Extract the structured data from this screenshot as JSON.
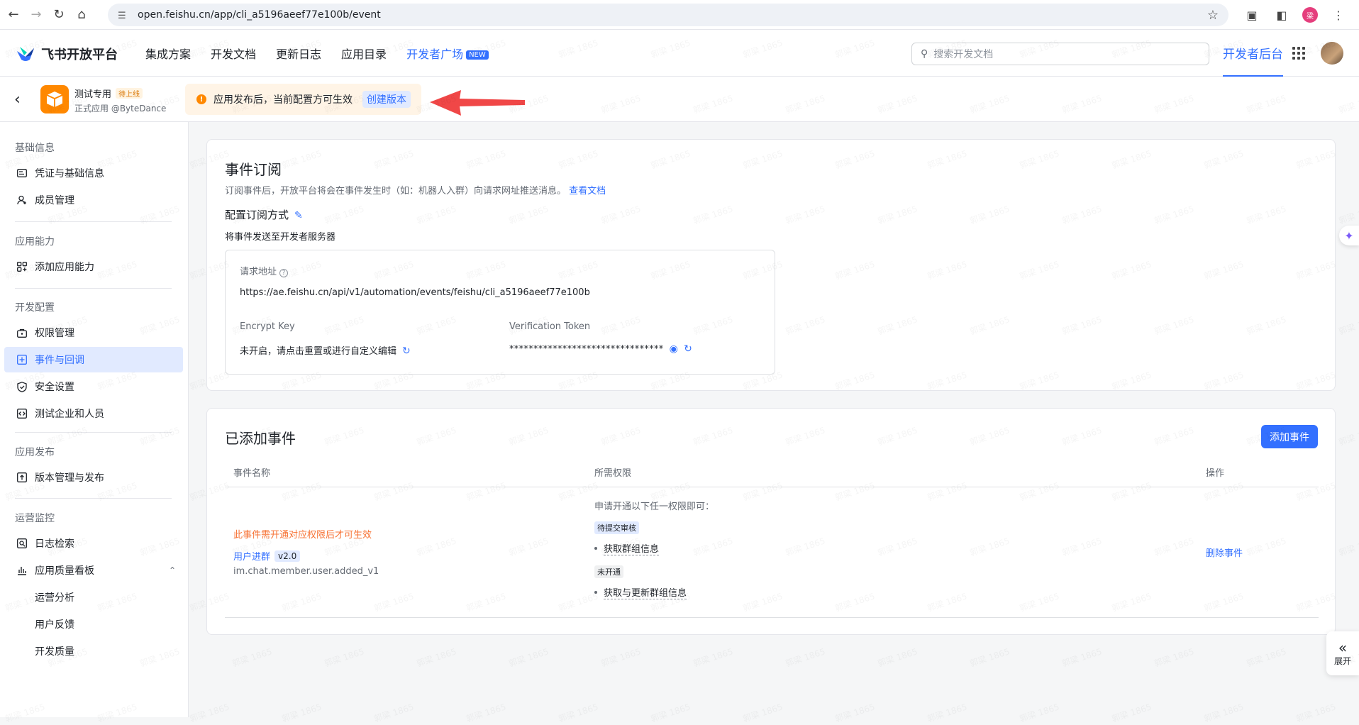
{
  "browser": {
    "url": "open.feishu.cn/app/cli_a5196aeef77e100b/event",
    "profile_initial": "梁",
    "icons": [
      "back-icon",
      "forward-icon",
      "reload-icon",
      "home-icon",
      "tune-icon",
      "star-icon",
      "extensions-icon",
      "sidepanel-icon",
      "menu-icon"
    ]
  },
  "header": {
    "logo_text": "飞书开放平台",
    "nav": [
      "集成方案",
      "开发文档",
      "更新日志",
      "应用目录"
    ],
    "nav_highlight": "开发者广场",
    "new_badge": "NEW",
    "search_placeholder": "搜索开发文档",
    "console": "开发者后台"
  },
  "app": {
    "name": "测试专用",
    "status": "待上线",
    "subtitle": "正式应用 @ByteDance",
    "notice": "应用发布后，当前配置方可生效",
    "create_version": "创建版本"
  },
  "sidebar": {
    "sections": {
      "basic": "基础信息",
      "ability": "应用能力",
      "dev": "开发配置",
      "release": "应用发布",
      "ops": "运营监控"
    },
    "items": {
      "credentials": "凭证与基础信息",
      "members": "成员管理",
      "add_ability": "添加应用能力",
      "permissions": "权限管理",
      "events": "事件与回调",
      "security": "安全设置",
      "test_org": "测试企业和人员",
      "version": "版本管理与发布",
      "logs": "日志检索",
      "quality": "应用质量看板",
      "ops_analysis": "运营分析",
      "feedback": "用户反馈",
      "dev_quality": "开发质量"
    }
  },
  "event_sub": {
    "title": "事件订阅",
    "desc": "订阅事件后，开放平台将会在事件发生时（如：机器人入群）向请求网址推送消息。",
    "doc_link": "查看文档",
    "config_title": "配置订阅方式",
    "mode": "将事件发送至开发者服务器",
    "request_url_label": "请求地址",
    "request_url": "https://ae.feishu.cn/api/v1/automation/events/feishu/cli_a5196aeef77e100b",
    "encrypt_label": "Encrypt Key",
    "encrypt_value": "未开启，请点击重置或进行自定义编辑",
    "token_label": "Verification Token",
    "token_value": "********************************"
  },
  "added_events": {
    "title": "已添加事件",
    "add_button": "添加事件",
    "columns": [
      "事件名称",
      "所需权限",
      "操作"
    ],
    "rows": [
      {
        "warning": "此事件需开通对应权限后才可生效",
        "name": "用户进群",
        "version": "v2.0",
        "code": "im.chat.member.user.added_v1",
        "perm_hint": "申请开通以下任一权限即可：",
        "perm1_status": "待提交审核",
        "perm1": "获取群组信息",
        "perm2_status": "未开通",
        "perm2": "获取与更新群组信息",
        "action": "删除事件"
      }
    ]
  },
  "expand_label": "展开",
  "watermark": "郭梁 1865"
}
